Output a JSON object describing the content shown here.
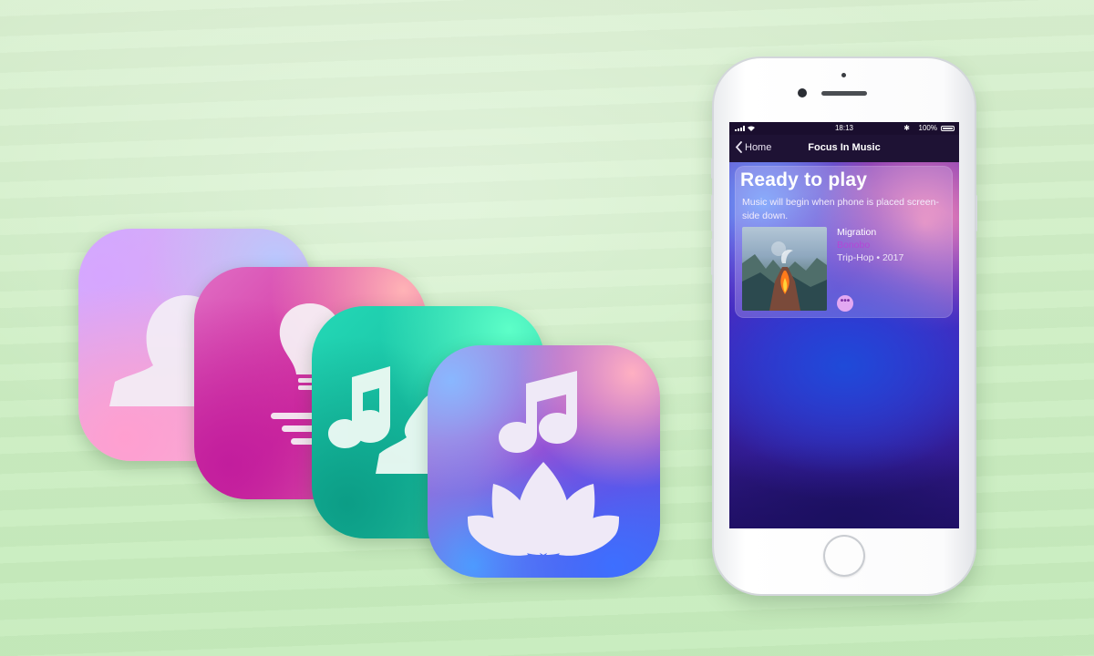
{
  "icons": [
    {
      "name": "contacts",
      "glyph": "person-silhouette-icon"
    },
    {
      "name": "ideas",
      "glyph": "lightbulb-icon"
    },
    {
      "name": "focus-people",
      "glyph": "music-note-person-icon"
    },
    {
      "name": "focus-music",
      "glyph": "music-note-lotus-icon"
    }
  ],
  "status_bar": {
    "time": "18:13",
    "battery": "100%"
  },
  "nav": {
    "back_label": "Home",
    "title": "Focus In Music"
  },
  "card": {
    "title": "Ready to play",
    "subtitle": "Music will begin when phone is placed screen-side down."
  },
  "track": {
    "title": "Migration",
    "artist": "Bonobo",
    "meta": "Trip-Hop • 2017",
    "more_label": "•••"
  },
  "colors": {
    "background": "#cdeec3",
    "artist_purple": "#b347d6",
    "nav_bar": "#1e1234"
  }
}
